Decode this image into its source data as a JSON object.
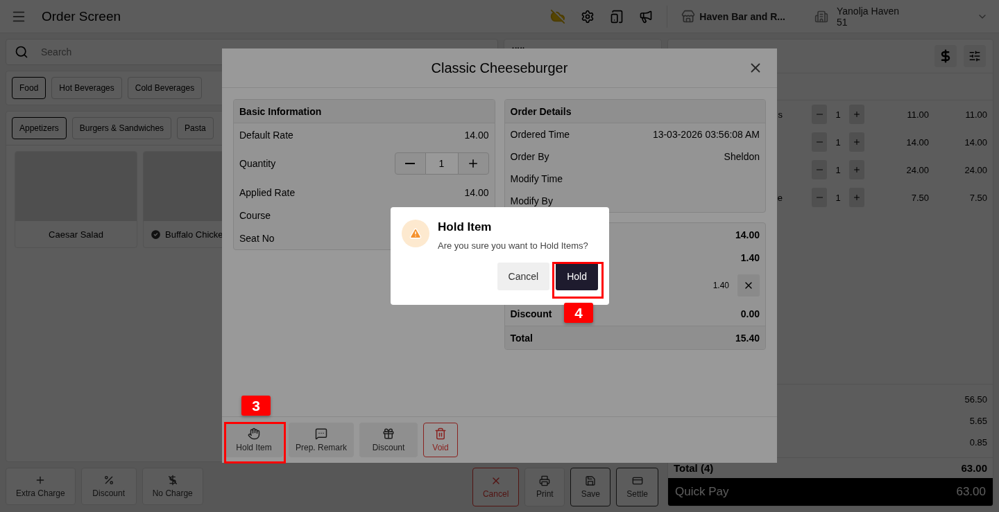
{
  "header": {
    "title": "Order Screen",
    "store": "Haven Bar and R...",
    "user_name": "Yanolja Haven",
    "user_code": "51"
  },
  "search": {
    "placeholder": "Search"
  },
  "categories": [
    {
      "label": "Food",
      "selected": true
    },
    {
      "label": "Hot Beverages",
      "selected": false
    },
    {
      "label": "Cold Beverages",
      "selected": false
    }
  ],
  "subcategories": [
    {
      "label": "Appetizers",
      "selected": true
    },
    {
      "label": "Burgers & Sandwiches",
      "selected": false
    },
    {
      "label": "Pasta",
      "selected": false
    }
  ],
  "menu_items": [
    {
      "name": "Caesar Salad",
      "checked": false
    },
    {
      "name": "Buffalo Chicke",
      "checked": true
    }
  ],
  "order_actions": [
    {
      "label": "Extra Charge"
    },
    {
      "label": "Discount"
    },
    {
      "label": "No Charge"
    }
  ],
  "footer_actions": [
    {
      "label": "Cancel",
      "kind": "danger"
    },
    {
      "label": "Print",
      "kind": "plain"
    },
    {
      "label": "Save",
      "kind": "outlined"
    },
    {
      "label": "Settle",
      "kind": "outlined"
    }
  ],
  "order_lines": [
    {
      "name": "s",
      "quantity": "1",
      "rate": "11.00",
      "amount": "11.00"
    },
    {
      "quantity": "1",
      "rate": "14.00",
      "amount": "14.00"
    },
    {
      "quantity": "1",
      "rate": "24.00",
      "amount": "24.00"
    },
    {
      "name": "e",
      "quantity": "1",
      "rate": "7.50",
      "amount": "7.50"
    }
  ],
  "summary": [
    {
      "value": "56.50"
    },
    {
      "value": "5.65"
    },
    {
      "value": "0.85"
    }
  ],
  "total": {
    "label": "Total (4)",
    "value": "63.00"
  },
  "quick_pay": {
    "label": "Quick Pay",
    "value": "63.00"
  },
  "item_dialog": {
    "title": "Classic Cheeseburger",
    "basic_information": {
      "title": "Basic Information",
      "default_rate_label": "Default Rate",
      "default_rate": "14.00",
      "quantity_label": "Quantity",
      "quantity": "1",
      "applied_rate_label": "Applied Rate",
      "applied_rate": "14.00",
      "course_label": "Course",
      "seat_label": "Seat No"
    },
    "order_details": {
      "title": "Order Details",
      "rows": [
        {
          "label": "Ordered Time",
          "value": "13-03-2026 03:56:08 AM"
        },
        {
          "label": "Order By",
          "value": "Sheldon"
        },
        {
          "label": "Modify Time"
        },
        {
          "label": "Modify By"
        }
      ]
    },
    "amounts": {
      "subtotal": "14.00",
      "tax": "1.40",
      "extra": "1.40",
      "discount_label": "Discount",
      "discount": "0.00",
      "total_label": "Total",
      "total": "15.40"
    },
    "actions": [
      {
        "label": "Hold Item",
        "kind": "plain"
      },
      {
        "label": "Prep. Remark",
        "kind": "plain"
      },
      {
        "label": "Discount",
        "kind": "plain"
      },
      {
        "label": "Void",
        "kind": "danger"
      }
    ]
  },
  "confirm_dialog": {
    "title": "Hold Item",
    "message": "Are you sure you want to Hold Items?",
    "cancel": "Cancel",
    "confirm": "Hold"
  },
  "annotations": [
    {
      "label": "3"
    },
    {
      "label": "4"
    }
  ]
}
